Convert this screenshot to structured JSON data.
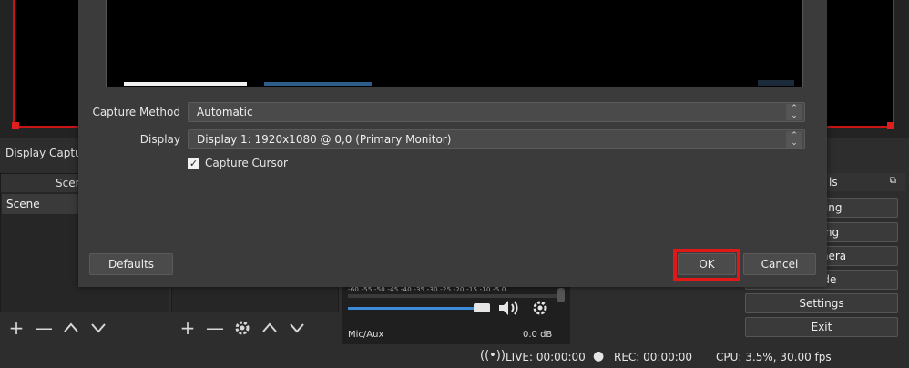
{
  "source_label": "Display Captur",
  "scenes_dock": {
    "title": "Scen",
    "items": [
      {
        "label": "Scene"
      }
    ]
  },
  "audio_mixer": {
    "scale": "-60 -55 -50 -45 -40 -35 -30 -25 -20 -15 -10 -5 0",
    "channel": "Mic/Aux",
    "level": "0.0 dB",
    "volume_fraction": 1.0
  },
  "controls": {
    "title": "ls",
    "buttons": [
      "eaming",
      "ording",
      "l Camera",
      "Mode",
      "Settings",
      "Exit"
    ]
  },
  "status_bar": {
    "live": "LIVE: 00:00:00",
    "rec": "REC: 00:00:00",
    "cpu": "CPU: 3.5%, 30.00 fps"
  },
  "dialog": {
    "capture_method_label": "Capture Method",
    "capture_method_value": "Automatic",
    "display_label": "Display",
    "display_value": "Display 1: 1920x1080 @ 0,0 (Primary Monitor)",
    "capture_cursor_label": "Capture Cursor",
    "capture_cursor_checked": true,
    "defaults_label": "Defaults",
    "ok_label": "OK",
    "cancel_label": "Cancel"
  },
  "colors": {
    "highlight": "#e01818",
    "accent": "#3c8bd8"
  }
}
